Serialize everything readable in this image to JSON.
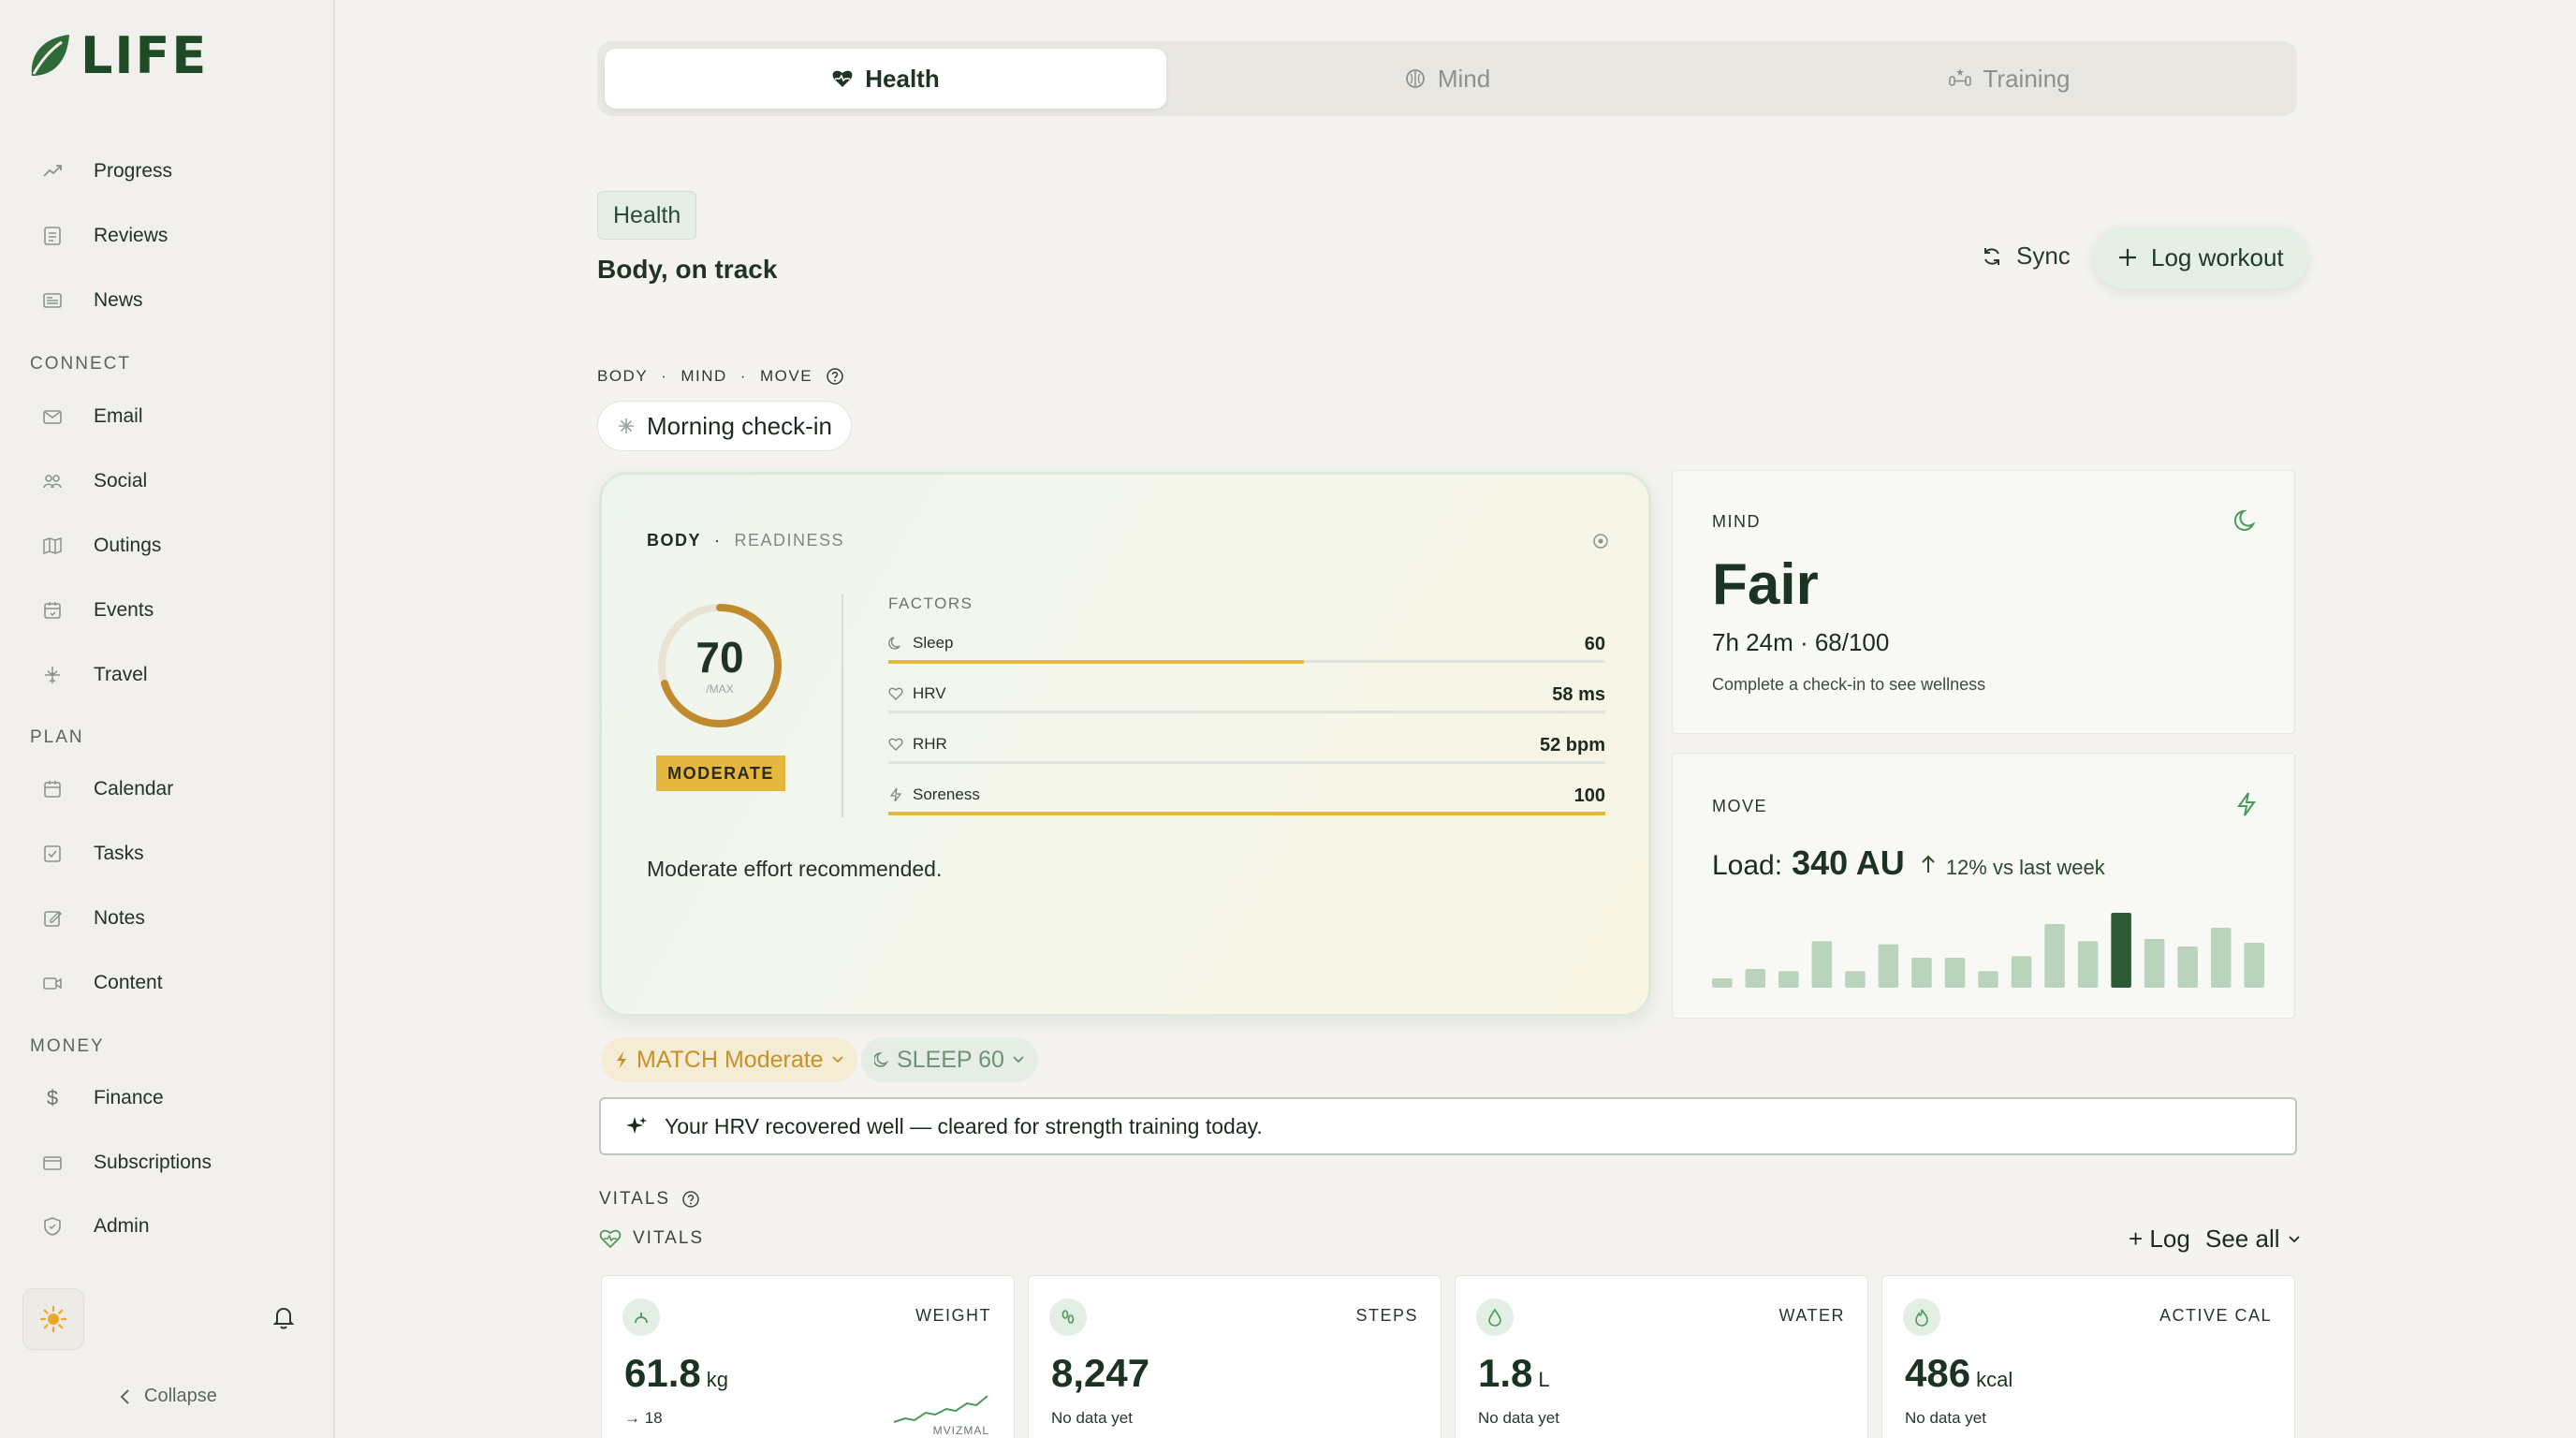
{
  "app": {
    "logo_text": "LIFE",
    "brand_color": "#1f4a26",
    "accent_color": "#e6b73f"
  },
  "sidebar": {
    "items_top": [
      {
        "label": "Progress",
        "icon": "trend-up-icon"
      },
      {
        "label": "Reviews",
        "icon": "document-icon"
      },
      {
        "label": "News",
        "icon": "newspaper-icon"
      }
    ],
    "sections": {
      "connect": "CONNECT",
      "plan": "PLAN",
      "money": "MONEY"
    },
    "connect_items": [
      {
        "label": "Email",
        "icon": "mail-icon"
      },
      {
        "label": "Social",
        "icon": "people-icon"
      },
      {
        "label": "Outings",
        "icon": "map-icon"
      },
      {
        "label": "Events",
        "icon": "calendar-event-icon"
      },
      {
        "label": "Travel",
        "icon": "plane-icon"
      }
    ],
    "plan_items": [
      {
        "label": "Calendar",
        "icon": "calendar-icon"
      },
      {
        "label": "Tasks",
        "icon": "checkbox-icon"
      },
      {
        "label": "Notes",
        "icon": "edit-icon"
      },
      {
        "label": "Content",
        "icon": "video-icon"
      }
    ],
    "money_items": [
      {
        "label": "Finance",
        "icon": "dollar-icon"
      },
      {
        "label": "Subscriptions",
        "icon": "card-icon"
      },
      {
        "label": "Admin",
        "icon": "shield-icon"
      }
    ],
    "collapse_label": "Collapse"
  },
  "tabs": [
    {
      "label": "Health",
      "icon": "heart-icon",
      "active": true
    },
    {
      "label": "Mind",
      "icon": "brain-icon",
      "active": false
    },
    {
      "label": "Training",
      "icon": "dumbbell-icon",
      "active": false
    }
  ],
  "header": {
    "pill": "Health",
    "subtitle": "Body, on track",
    "sync_label": "Sync",
    "log_workout_label": "Log workout"
  },
  "crumbs": {
    "a": "BODY",
    "b": "MIND",
    "c": "MOVE",
    "sep": "·"
  },
  "checkin_label": "Morning check-in",
  "readiness": {
    "label": "BODY",
    "sub": "READINESS",
    "score": "70",
    "score_value": 70,
    "score_sub": "/MAX",
    "badge": "MODERATE",
    "factors_title": "FACTORS",
    "factors": [
      {
        "name": "Sleep",
        "value": "60",
        "fill": 0.58
      },
      {
        "name": "HRV",
        "value": "58 ms",
        "fill": 0
      },
      {
        "name": "RHR",
        "value": "52 bpm",
        "fill": 0
      },
      {
        "name": "Soreness",
        "value": "100",
        "fill": 1.0
      }
    ],
    "note": "Moderate effort recommended."
  },
  "mind": {
    "label": "MIND",
    "state": "Fair",
    "stat": "7h 24m · 68/100",
    "hint": "Complete a check-in to see wellness"
  },
  "move": {
    "label": "MOVE",
    "load_prefix": "Load:",
    "load_value": "340 AU",
    "delta": "12% vs last week",
    "bars": [
      0.12,
      0.25,
      0.22,
      0.62,
      0.22,
      0.58,
      0.4,
      0.4,
      0.22,
      0.42,
      0.85,
      0.62,
      1.0,
      0.65,
      0.55,
      0.8,
      0.6
    ],
    "highlight_index": 12
  },
  "chips": {
    "match": "MATCH Moderate",
    "sleep": "SLEEP 60"
  },
  "insight": "Your HRV recovered well — cleared for strength training today.",
  "vitals": {
    "title": "VITALS",
    "subtitle": "VITALS",
    "log_label": "+ Log",
    "see_all_label": "See all",
    "cards": [
      {
        "name": "WEIGHT",
        "value": "61.8",
        "unit": "kg",
        "foot": "→ 18",
        "spark_label": "MVIZMAL",
        "icon": "scale-icon"
      },
      {
        "name": "STEPS",
        "value": "8,247",
        "unit": "",
        "foot": "No data yet",
        "icon": "footsteps-icon"
      },
      {
        "name": "WATER",
        "value": "1.8",
        "unit": "L",
        "foot": "No data yet",
        "icon": "water-drop-icon"
      },
      {
        "name": "ACTIVE CAL",
        "value": "486",
        "unit": "kcal",
        "foot": "No data yet",
        "icon": "flame-icon"
      }
    ]
  }
}
